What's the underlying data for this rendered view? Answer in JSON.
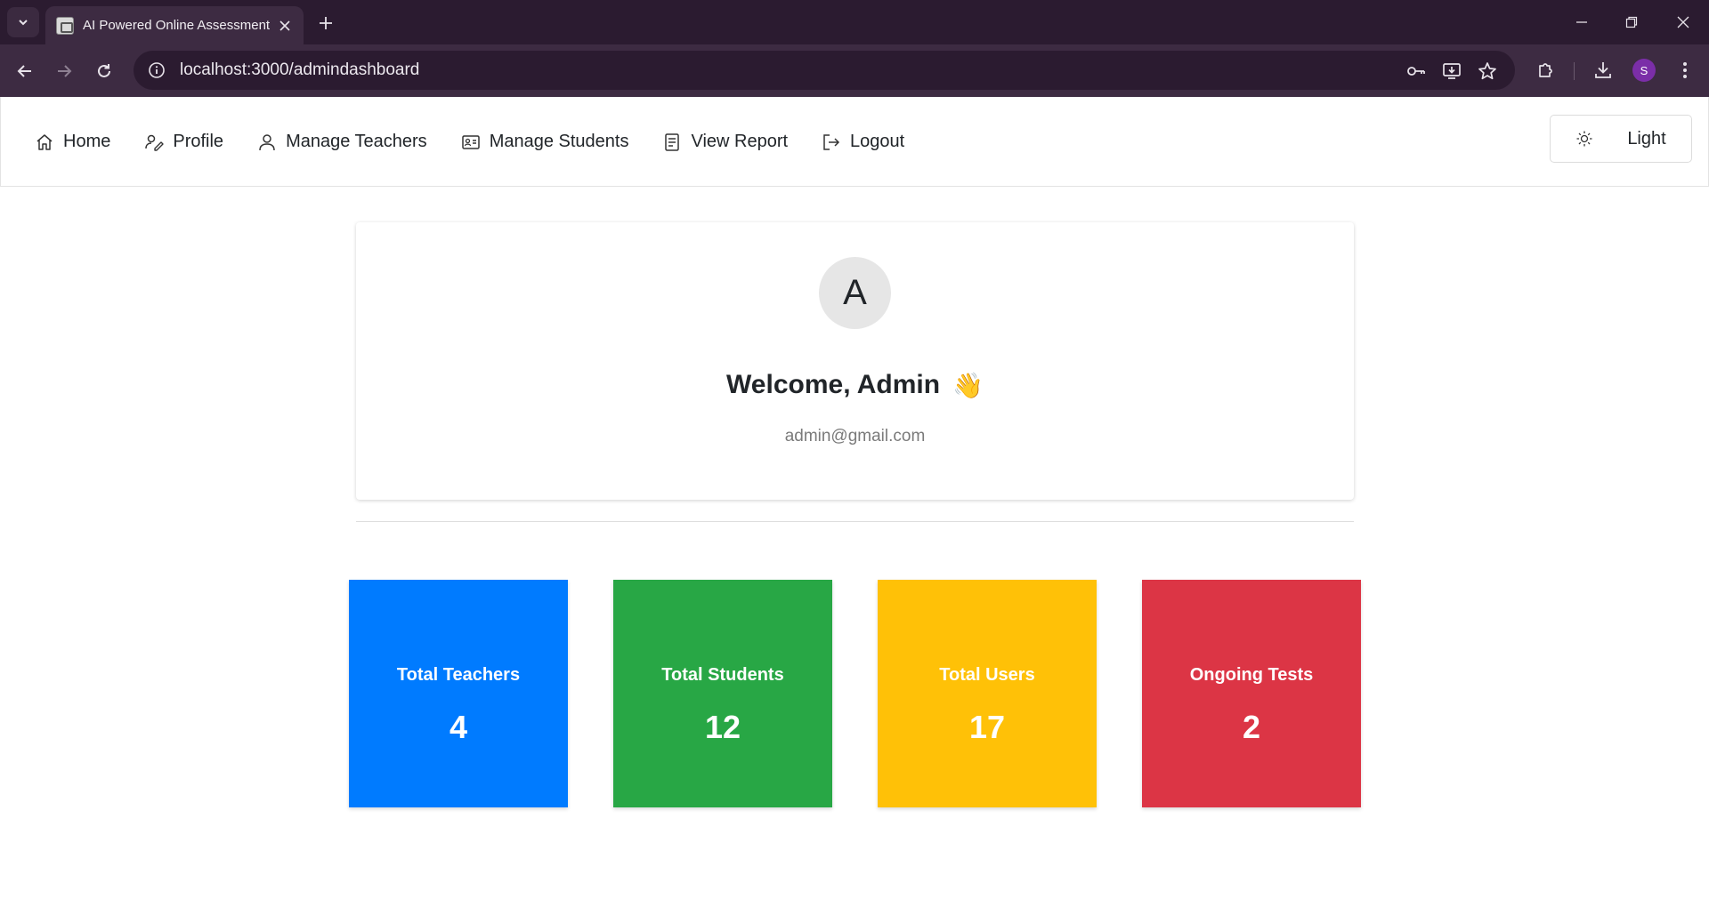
{
  "browser": {
    "tab_title": "AI Powered Online Assessment",
    "url": "localhost:3000/admindashboard",
    "profile_initial": "S"
  },
  "nav": {
    "items": [
      {
        "label": "Home",
        "icon": "home-icon"
      },
      {
        "label": "Profile",
        "icon": "profile-edit-icon"
      },
      {
        "label": "Manage Teachers",
        "icon": "person-icon"
      },
      {
        "label": "Manage Students",
        "icon": "id-card-icon"
      },
      {
        "label": "View Report",
        "icon": "report-icon"
      },
      {
        "label": "Logout",
        "icon": "logout-icon"
      }
    ],
    "theme_label": "Light"
  },
  "welcome": {
    "avatar_letter": "A",
    "greeting": "Welcome, Admin",
    "emoji": "👋",
    "email": "admin@gmail.com"
  },
  "stats": [
    {
      "label": "Total Teachers",
      "value": "4",
      "color": "#007bff"
    },
    {
      "label": "Total Students",
      "value": "12",
      "color": "#28a745"
    },
    {
      "label": "Total Users",
      "value": "17",
      "color": "#ffc107"
    },
    {
      "label": "Ongoing Tests",
      "value": "2",
      "color": "#dc3545"
    }
  ]
}
